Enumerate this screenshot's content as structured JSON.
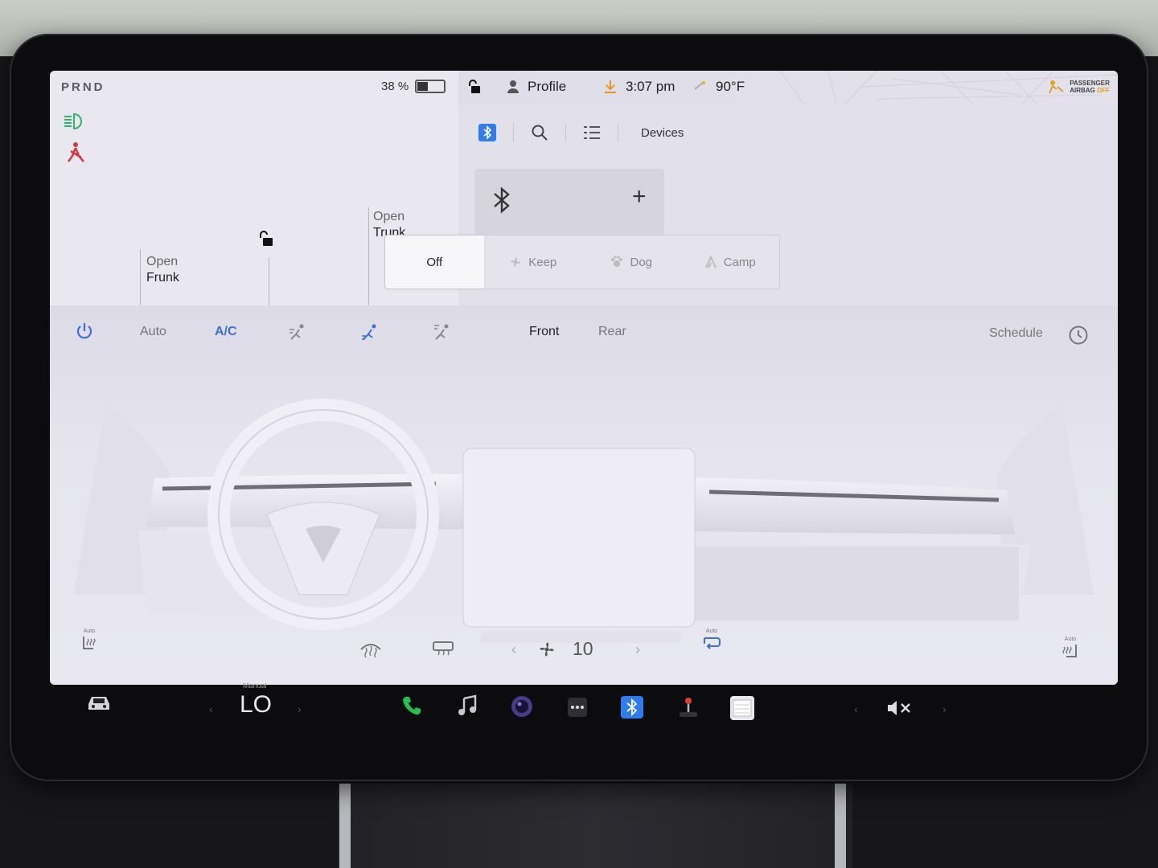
{
  "status": {
    "gear": "PRND",
    "battery_text": "38 %",
    "battery_level": 0.38,
    "profile": "Profile",
    "time": "3:07 pm",
    "temperature": "90°F",
    "airbag_line1": "PASSENGER",
    "airbag_line2": "AIRBAG",
    "airbag_state": "OFF"
  },
  "car": {
    "frunk_open": "Open",
    "frunk_name": "Frunk",
    "trunk_open": "Open",
    "trunk_name": "Trunk"
  },
  "bluetooth": {
    "devices_label": "Devices",
    "add_symbol": "+"
  },
  "modes": {
    "items": [
      {
        "label": "Off",
        "icon": "off"
      },
      {
        "label": "Keep",
        "icon": "fan-icon"
      },
      {
        "label": "Dog",
        "icon": "paw-icon"
      },
      {
        "label": "Camp",
        "icon": "tent-icon"
      }
    ],
    "selected": "Off"
  },
  "climate": {
    "auto": "Auto",
    "ac": "A/C",
    "front": "Front",
    "rear": "Rear",
    "schedule": "Schedule",
    "fan_speed": "10",
    "seat_auto_label": "Auto",
    "recirc_auto_label": "Auto",
    "accent_color": "#3b6fe0"
  },
  "taskbar": {
    "temp_mode": "Manual",
    "temp_value": "LO",
    "phone_color": "#1fc24a",
    "bluetooth_color": "#2f7cf0"
  }
}
